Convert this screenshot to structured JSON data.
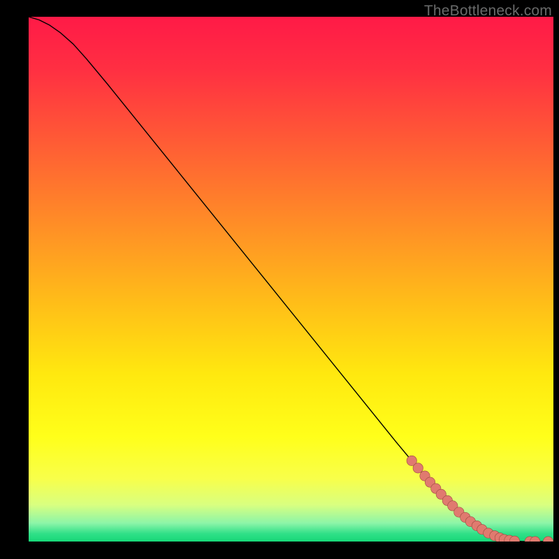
{
  "attribution": "TheBottleneck.com",
  "chart_data": {
    "type": "line",
    "title": "",
    "xlabel": "",
    "ylabel": "",
    "xlim": [
      0,
      100
    ],
    "ylim": [
      0,
      100
    ],
    "grid": false,
    "axes_visible": false,
    "background_gradient_stops": [
      {
        "offset": 0.0,
        "color": "#ff1a47"
      },
      {
        "offset": 0.1,
        "color": "#ff2f42"
      },
      {
        "offset": 0.25,
        "color": "#ff5f34"
      },
      {
        "offset": 0.4,
        "color": "#ff8f26"
      },
      {
        "offset": 0.55,
        "color": "#ffbf18"
      },
      {
        "offset": 0.68,
        "color": "#ffe80f"
      },
      {
        "offset": 0.8,
        "color": "#ffff1a"
      },
      {
        "offset": 0.88,
        "color": "#f8ff4a"
      },
      {
        "offset": 0.93,
        "color": "#d9ff80"
      },
      {
        "offset": 0.965,
        "color": "#8cf5a8"
      },
      {
        "offset": 0.985,
        "color": "#30e088"
      },
      {
        "offset": 1.0,
        "color": "#17d878"
      }
    ],
    "series": [
      {
        "name": "bottleneck-curve",
        "stroke": "#000000",
        "stroke_width": 1.4,
        "x": [
          0.0,
          2.0,
          4.0,
          6.0,
          8.5,
          11.0,
          15.0,
          20.0,
          30.0,
          40.0,
          50.0,
          60.0,
          70.0,
          78.0,
          84.0,
          88.0,
          91.0,
          94.0,
          100.0
        ],
        "values": [
          100.0,
          99.4,
          98.4,
          97.0,
          94.8,
          92.0,
          87.2,
          81.0,
          68.6,
          56.2,
          43.8,
          31.4,
          19.0,
          9.4,
          3.6,
          1.1,
          0.25,
          0.0,
          0.0
        ]
      }
    ],
    "markers": {
      "name": "highlight-points",
      "fill": "#e07a6f",
      "stroke": "#9c4a40",
      "radius": 7.2,
      "x": [
        73.0,
        74.2,
        75.5,
        76.5,
        77.6,
        78.6,
        79.8,
        80.8,
        82.0,
        83.2,
        84.2,
        85.4,
        86.4,
        87.6,
        88.8,
        89.8,
        90.6,
        91.6,
        92.6,
        95.5,
        96.5,
        99.0
      ],
      "values": [
        15.4,
        14.0,
        12.5,
        11.3,
        10.1,
        9.0,
        7.8,
        6.8,
        5.6,
        4.6,
        3.8,
        3.0,
        2.3,
        1.6,
        1.1,
        0.7,
        0.4,
        0.25,
        0.1,
        0.0,
        0.0,
        0.0
      ]
    }
  }
}
